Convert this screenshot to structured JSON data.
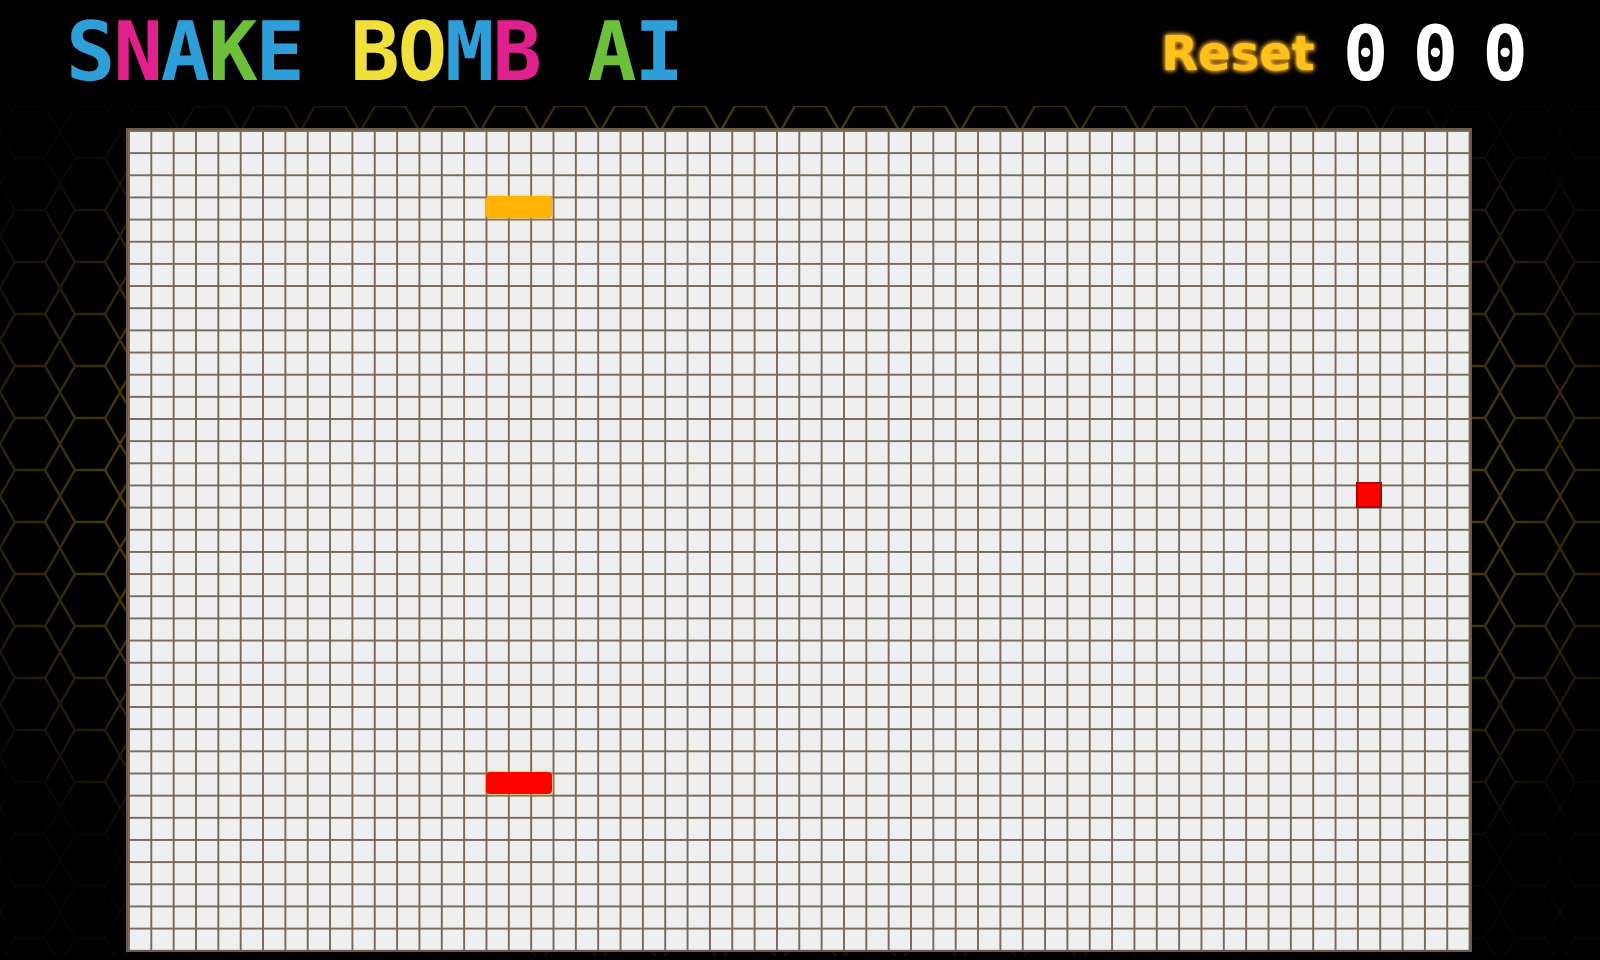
{
  "title": {
    "segments": [
      {
        "text": "S",
        "color": "#2e9fd8"
      },
      {
        "text": "N",
        "color": "#e0208c"
      },
      {
        "text": "A",
        "color": "#2e9fd8"
      },
      {
        "text": "K",
        "color": "#6cc03a"
      },
      {
        "text": "E ",
        "color": "#2e9fd8"
      },
      {
        "text": "B",
        "color": "#f2e03a"
      },
      {
        "text": "O",
        "color": "#f2e03a"
      },
      {
        "text": "M",
        "color": "#2e9fd8"
      },
      {
        "text": "B ",
        "color": "#e0208c"
      },
      {
        "text": "A",
        "color": "#6cc03a"
      },
      {
        "text": "I",
        "color": "#2e9fd8"
      }
    ]
  },
  "reset_button": {
    "label": "Reset"
  },
  "score": "000",
  "pieces": [
    {
      "kind": "snake",
      "color": "#ffb300"
    },
    {
      "kind": "snake",
      "color": "#ff0000"
    },
    {
      "kind": "bomb",
      "color": "#ff0000"
    }
  ]
}
